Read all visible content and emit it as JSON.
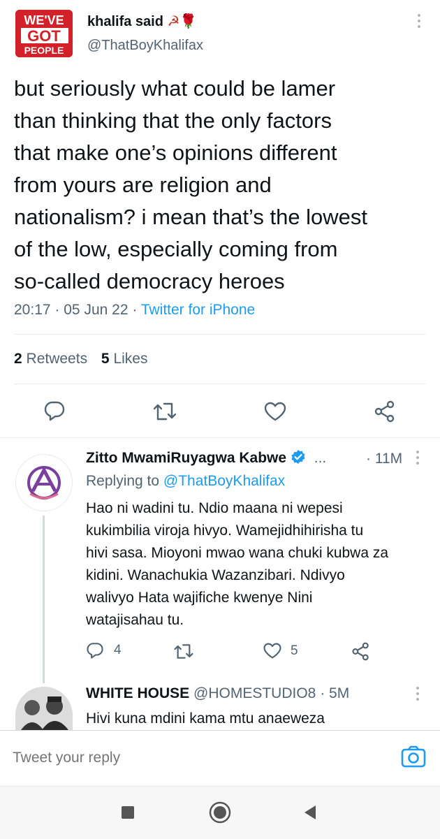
{
  "tweet": {
    "avatar": {
      "line1": "WE'VE",
      "line2": "GOT",
      "line3": "PEOPLE"
    },
    "display_name": "khalifa said",
    "name_emoji": "☭🌹",
    "handle": "@ThatBoyKhalifax",
    "text_lines": [
      "but seriously what could be lamer",
      "than thinking that the only factors",
      "that make one’s opinions different",
      "from yours are religion and",
      "nationalism? i mean that’s the lowest",
      "of the low, especially coming from",
      "so-called democracy heroes"
    ],
    "time": "20:17",
    "sep": "·",
    "date": "05 Jun 22",
    "source": "Twitter for iPhone",
    "retweets_count": "2",
    "retweets_label": "Retweets",
    "likes_count": "5",
    "likes_label": "Likes"
  },
  "replies": [
    {
      "display_name": "Zitto MwamiRuyagwa Kabwe",
      "ellipsis": "...",
      "time": "· 11M",
      "replying_prefix": "Replying to",
      "replying_to": "@ThatBoyKhalifax",
      "text_lines": [
        "Hao ni wadini tu. Ndio maana ni wepesi",
        "kukimbilia viroja hivyo. Wamejidhihirisha tu",
        "hivi sasa. Mioyoni mwao wana chuki kubwa za",
        "kidini. Wanachukia Wazanzibari. Ndivyo",
        "walivyo Hata wajifiche kwenye Nini",
        "watajisahau tu."
      ],
      "reply_count": "4",
      "like_count": "5"
    },
    {
      "display_name": "WHITE HOUSE",
      "handle": "@HOMESTUDIO8",
      "time": "· 5M",
      "text_lines": [
        "Hivi kuna mdini kama mtu anaeweza"
      ]
    }
  ],
  "composer": {
    "placeholder": "Tweet your reply"
  },
  "colors": {
    "accent": "#1d9bf0",
    "text": "#0f1419",
    "muted": "#536471",
    "avatar_red": "#d22128",
    "avatar_purple": "#7b3fa0"
  }
}
